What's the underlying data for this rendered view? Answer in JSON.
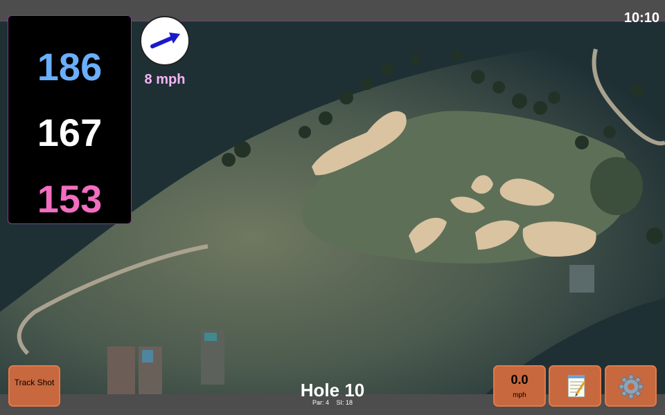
{
  "status_bar": {
    "time": "10:10"
  },
  "distances": {
    "back": "186",
    "middle": "167",
    "front": "153"
  },
  "wind": {
    "speed_label": "8 mph",
    "direction_icon": "arrow-icon"
  },
  "hole": {
    "title": "Hole 10",
    "par_label": "Par: 4",
    "si_label": "SI: 18"
  },
  "controls": {
    "track_shot_label": "Track Shot",
    "speed_value": "0.0",
    "speed_unit": "mph",
    "notes_icon": "notepad-icon",
    "settings_icon": "gear-icon"
  },
  "colors": {
    "back_distance": "#6aaefc",
    "middle_distance": "#ffffff",
    "front_distance": "#f26ec0",
    "wind_text": "#f6b4f4",
    "button_bg": "#c8683e"
  }
}
